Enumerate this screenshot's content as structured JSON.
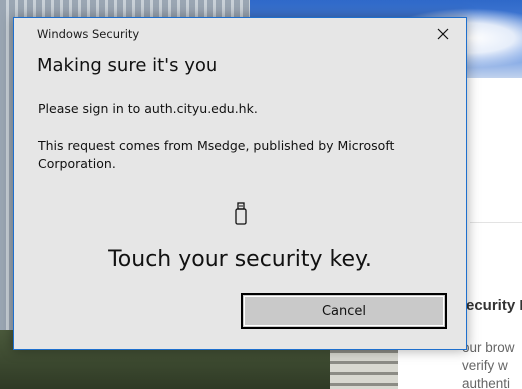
{
  "background": {
    "page_title_partial": "ecurity K",
    "page_body_lines": [
      "our brow",
      "verify w",
      "authenti"
    ]
  },
  "dialog": {
    "window_title": "Windows Security",
    "heading": "Making sure it's you",
    "sign_in_text": "Please sign in to auth.cityu.edu.hk.",
    "request_text": "This request comes from Msedge, published by Microsoft Corporation.",
    "prompt": "Touch your security key.",
    "cancel_label": "Cancel",
    "close_icon": "close-icon",
    "key_icon": "usb-security-key-icon",
    "accent_color": "#1e6fcd"
  }
}
